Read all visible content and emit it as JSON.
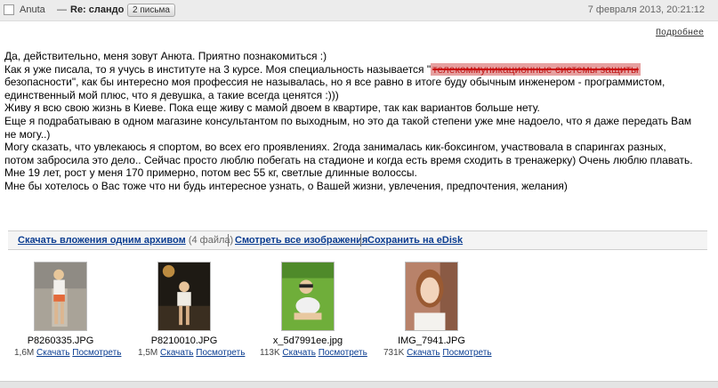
{
  "header": {
    "sender": "Anuta",
    "dash": "—",
    "subject": "Re: сландо",
    "count_badge": "2 письма",
    "date": "7 февраля 2013, 20:21:12"
  },
  "more_link": "Подробнее",
  "body": {
    "lines": [
      "Да, действительно, меня зовут Анюта. Приятно познакомиться :)",
      "Как я уже писала, то я учусь в институте на 3 курсе. Моя специальность называется \"",
      "безопасности\", как бы интересно моя профессия не называлась, но я все равно в итоге буду обычным инженером - программистом,",
      "единственный мой плюс, что я девушка, а такие всегда ценятся :)))",
      "Живу я всю свою жизнь в Киеве. Пока еще живу с мамой двоем в квартире, так как вариантов больше нету.",
      " Еще я подрабатываю в одном магазине консультантом по выходным, но это да такой степени уже мне надоело, что я даже передать Вам",
      "не могу..)",
      " Могу сказать, что увлекаюсь я спортом, во всех его проявлениях. 2года занималась кик-боксингом, участвовала в спарингах разных,",
      "потом забросила это дело.. Сейчас просто люблю побегать на стадионе и когда есть время сходить в тренажерку) Очень люблю плавать.",
      "Мне 19 лет, рост у меня 170 примерно, потом вес 55 кг, светлые длинные волоссы.",
      "Мне бы хотелось о Вас тоже что ни будь интересное узнать, о Вашей жизни,  увлечения, предпочтения, желания)"
    ],
    "redacted_text": "телекоммуникационные системы защиты"
  },
  "attachments_bar": {
    "download_all": "Скачать вложения одним архивом",
    "file_count": "(4 файла)",
    "view_all": "Смотреть все изображения",
    "save_disk": "Сохранить на eDisk"
  },
  "attachments": [
    {
      "name": "P8260335.JPG",
      "size": "1,6M",
      "download": "Скачать",
      "view": "Посмотреть"
    },
    {
      "name": "P8210010.JPG",
      "size": "1,5M",
      "download": "Скачать",
      "view": "Посмотреть"
    },
    {
      "name": "x_5d7991ee.jpg",
      "size": "113K",
      "download": "Скачать",
      "view": "Посмотреть"
    },
    {
      "name": "IMG_7941.JPG",
      "size": "731K",
      "download": "Скачать",
      "view": "Посмотреть"
    }
  ],
  "colors": {
    "link": "#0b3d91",
    "header_bg": "#ececec",
    "redaction": "#cc1010"
  }
}
